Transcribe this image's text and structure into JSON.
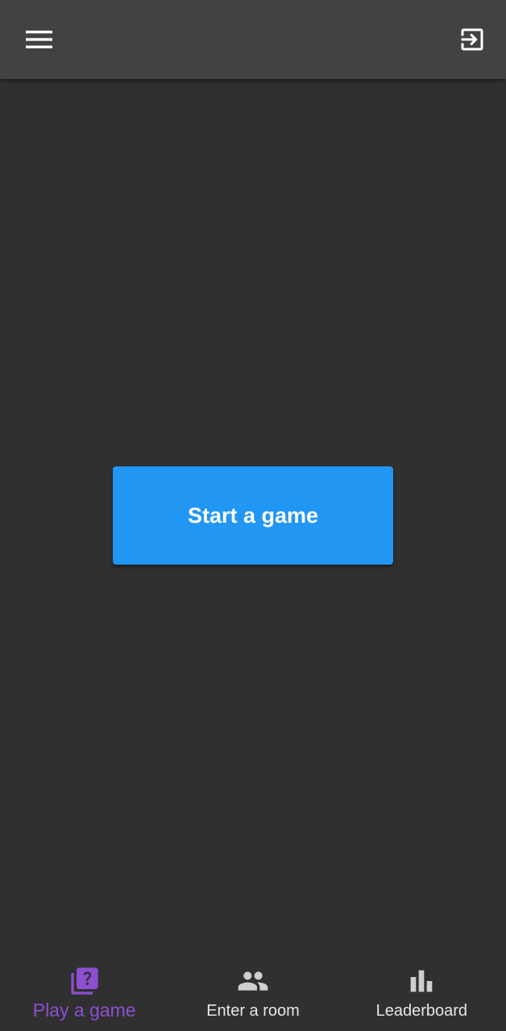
{
  "colors": {
    "background": "#303030",
    "app_bar": "#424242",
    "primary_button": "#2196F3",
    "active_nav": "#8c4fd0",
    "inactive_nav": "#e6e6e6"
  },
  "app_bar": {
    "menu_icon": "hamburger-menu-icon",
    "exit_icon": "exit-to-app-icon"
  },
  "main": {
    "start_button_label": "Start a game"
  },
  "bottom_nav": {
    "items": [
      {
        "label": "Play a game",
        "icon": "quiz-icon",
        "active": true
      },
      {
        "label": "Enter a room",
        "icon": "people-icon",
        "active": false
      },
      {
        "label": "Leaderboard",
        "icon": "bar-chart-icon",
        "active": false
      }
    ]
  }
}
